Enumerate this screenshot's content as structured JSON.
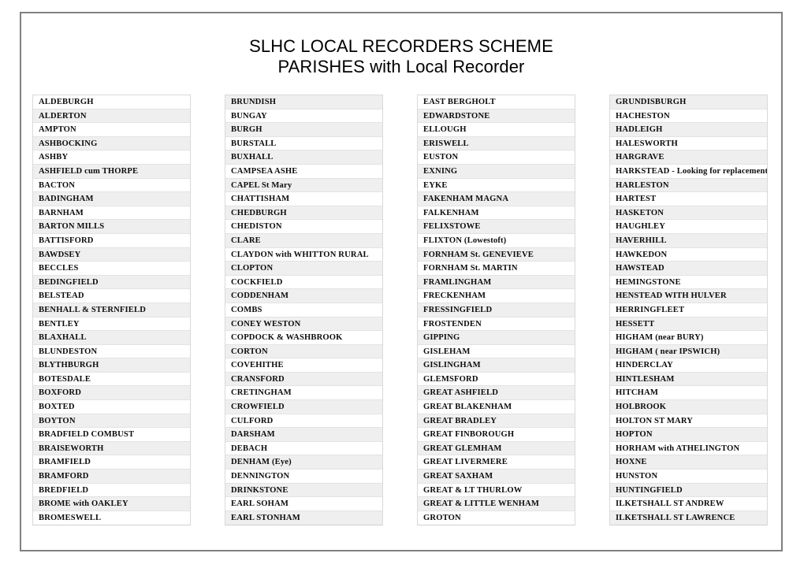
{
  "document": {
    "title_line_1": "SLHC LOCAL RECORDERS SCHEME",
    "title_line_2": "PARISHES with Local Recorder"
  },
  "colors": {
    "frame_border": "#808080",
    "row_shade": "#efefef",
    "row_plain": "#ffffff",
    "cell_border": "#e3e3e3",
    "text": "#0d0d0d"
  },
  "columns": [
    {
      "column_index": 1,
      "starts_shaded": false,
      "entries": [
        "ALDEBURGH",
        "ALDERTON",
        "AMPTON",
        "ASHBOCKING",
        "ASHBY",
        "ASHFIELD cum THORPE",
        "BACTON",
        "BADINGHAM",
        "BARNHAM",
        "BARTON MILLS",
        "BATTISFORD",
        "BAWDSEY",
        "BECCLES",
        "BEDINGFIELD",
        "BELSTEAD",
        "BENHALL & STERNFIELD",
        "BENTLEY",
        "BLAXHALL",
        "BLUNDESTON",
        "BLYTHBURGH",
        "BOTESDALE",
        "BOXFORD",
        "BOXTED",
        "BOYTON",
        "BRADFIELD COMBUST",
        "BRAISEWORTH",
        "BRAMFIELD",
        "BRAMFORD",
        "BREDFIELD",
        "BROME with OAKLEY",
        "BROMESWELL"
      ]
    },
    {
      "column_index": 2,
      "starts_shaded": true,
      "entries": [
        "BRUNDISH",
        "BUNGAY",
        "BURGH",
        "BURSTALL",
        "BUXHALL",
        "CAMPSEA ASHE",
        "CAPEL St Mary",
        "CHATTISHAM",
        "CHEDBURGH",
        "CHEDISTON",
        "CLARE",
        "CLAYDON with WHITTON RURAL",
        "CLOPTON",
        "COCKFIELD",
        "CODDENHAM",
        "COMBS",
        "CONEY WESTON",
        "COPDOCK & WASHBROOK",
        "CORTON",
        "COVEHITHE",
        "CRANSFORD",
        "CRETINGHAM",
        "CROWFIELD",
        "CULFORD",
        "DARSHAM",
        "DEBACH",
        "DENHAM (Eye)",
        "DENNINGTON",
        "DRINKSTONE",
        "EARL SOHAM",
        "EARL STONHAM"
      ]
    },
    {
      "column_index": 3,
      "starts_shaded": false,
      "entries": [
        "EAST BERGHOLT",
        "EDWARDSTONE",
        "ELLOUGH",
        "ERISWELL",
        "EUSTON",
        "EXNING",
        "EYKE",
        "FAKENHAM MAGNA",
        "FALKENHAM",
        "FELIXSTOWE",
        "FLIXTON (Lowestoft)",
        "FORNHAM St. GENEVIEVE",
        "FORNHAM St. MARTIN",
        "FRAMLINGHAM",
        "FRECKENHAM",
        "FRESSINGFIELD",
        "FROSTENDEN",
        "GIPPING",
        "GISLEHAM",
        "GISLINGHAM",
        "GLEMSFORD",
        "GREAT ASHFIELD",
        "GREAT BLAKENHAM",
        "GREAT BRADLEY",
        "GREAT FINBOROUGH",
        "GREAT GLEMHAM",
        "GREAT LIVERMERE",
        "GREAT SAXHAM",
        "GREAT  & LT THURLOW",
        "GREAT & LITTLE WENHAM",
        "GROTON"
      ]
    },
    {
      "column_index": 4,
      "starts_shaded": true,
      "entries": [
        "GRUNDISBURGH",
        "HACHESTON",
        "HADLEIGH",
        "HALESWORTH",
        "HARGRAVE",
        "HARKSTEAD  - Looking for replacement",
        "HARLESTON",
        "HARTEST",
        "HASKETON",
        "HAUGHLEY",
        "HAVERHILL",
        "HAWKEDON",
        "HAWSTEAD",
        "HEMINGSTONE",
        "HENSTEAD WITH HULVER",
        "HERRINGFLEET",
        "HESSETT",
        "HIGHAM (near BURY)",
        "HIGHAM ( near IPSWICH)",
        "HINDERCLAY",
        "HINTLESHAM",
        "HITCHAM",
        "HOLBROOK",
        "HOLTON ST MARY",
        "HOPTON",
        "HORHAM with ATHELINGTON",
        "HOXNE",
        "HUNSTON",
        "HUNTINGFIELD",
        "ILKETSHALL ST ANDREW",
        "ILKETSHALL ST LAWRENCE"
      ]
    }
  ]
}
